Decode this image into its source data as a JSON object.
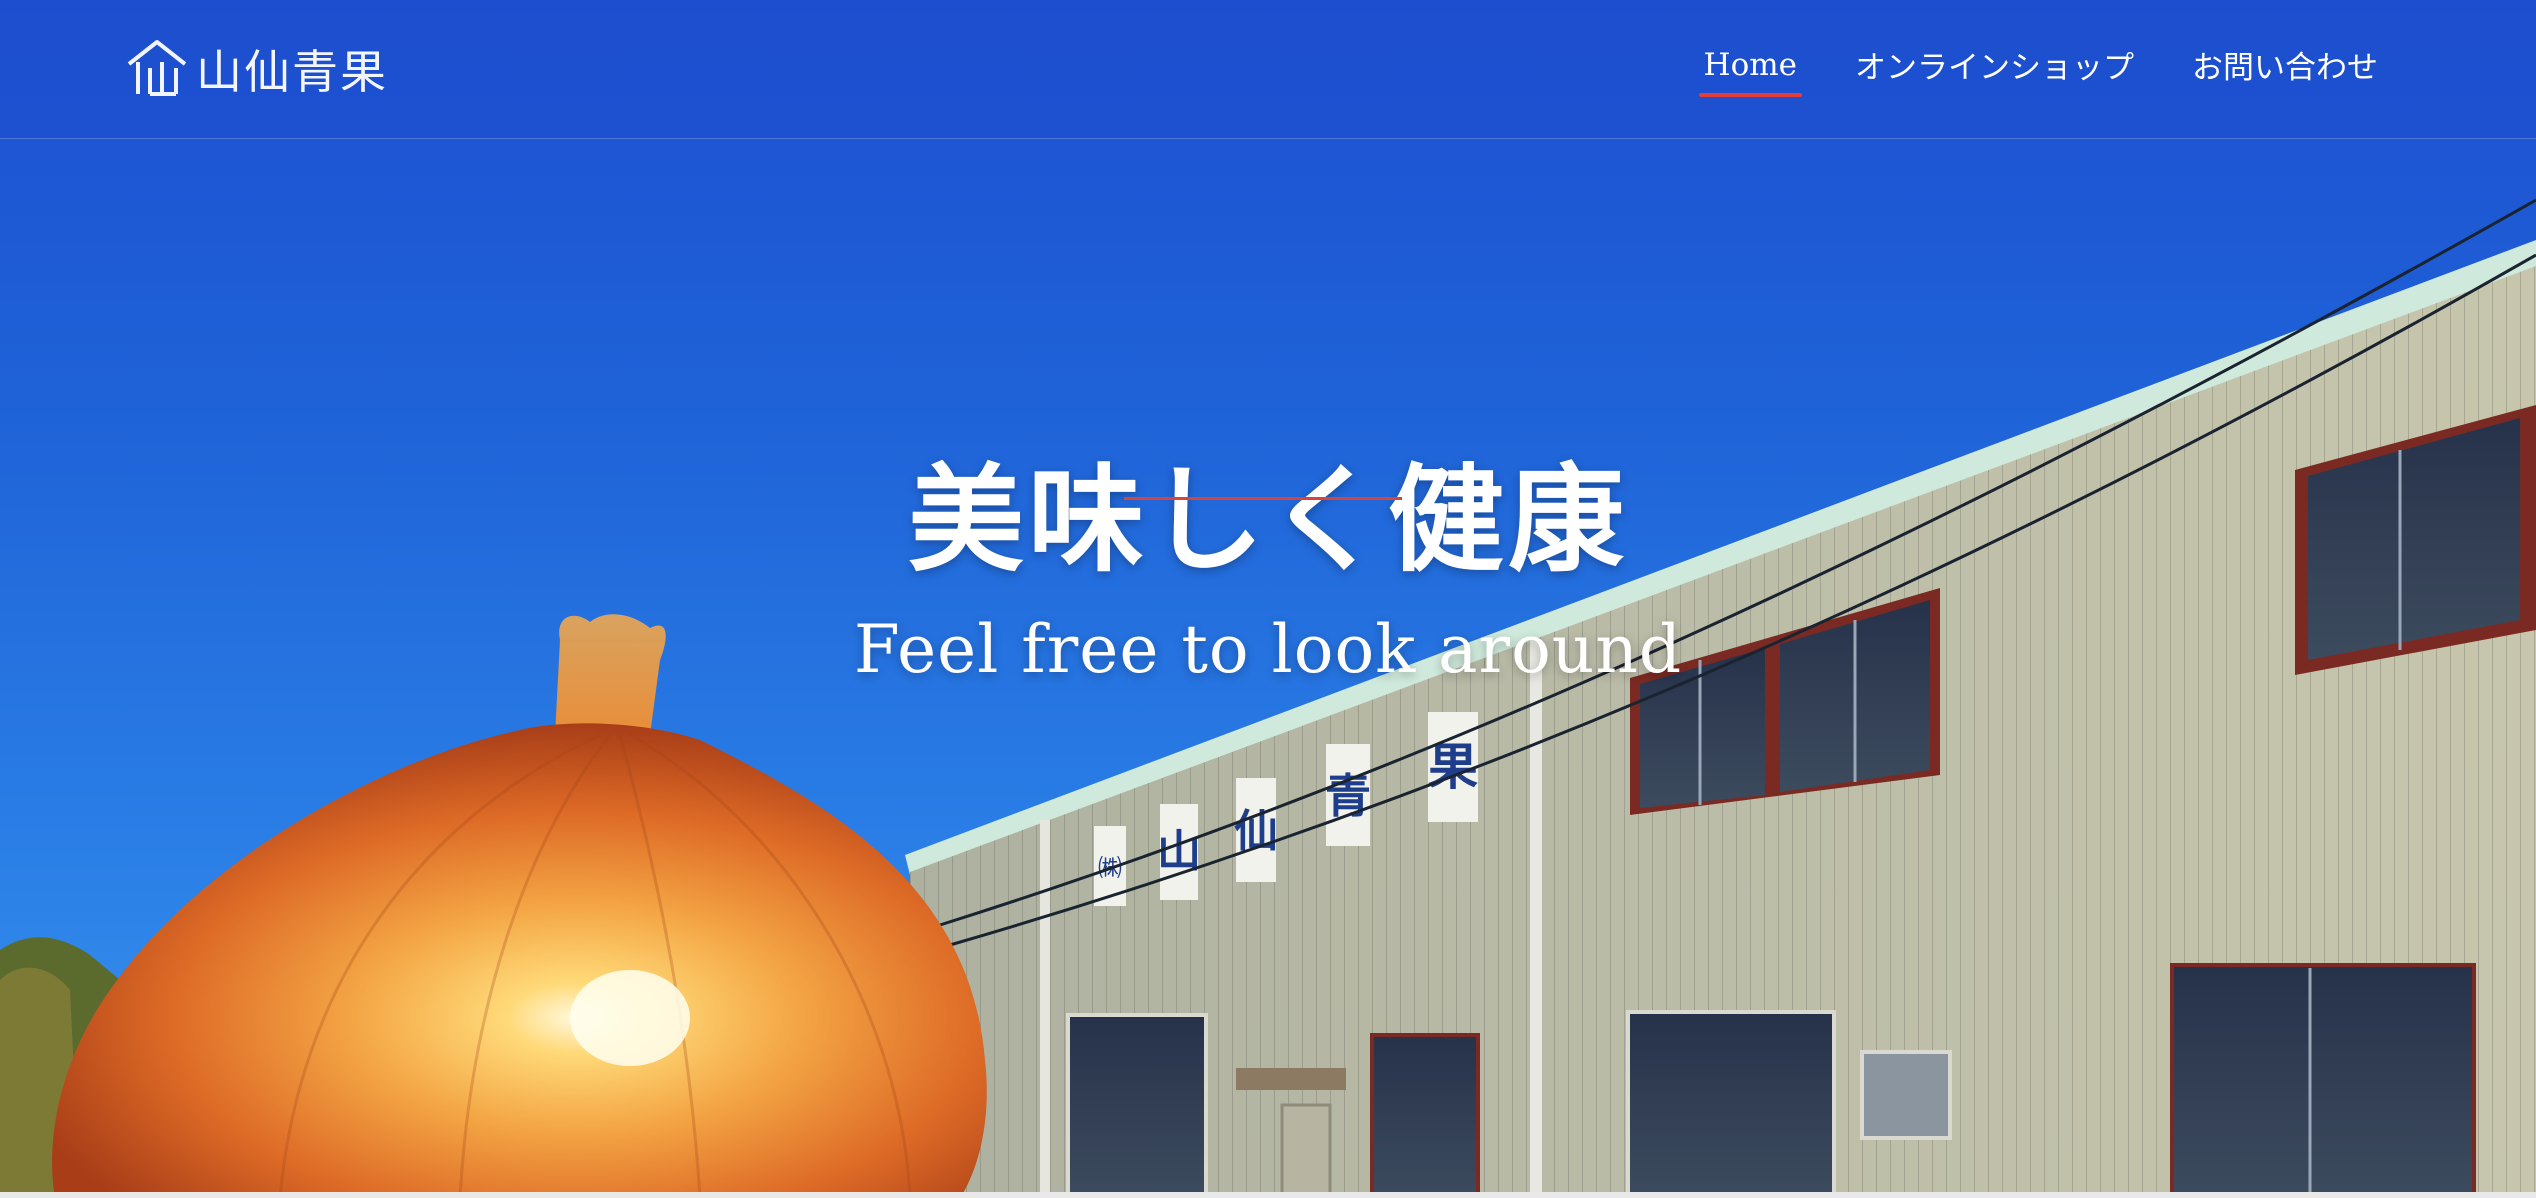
{
  "brand": {
    "name": "山仙青果",
    "logo_icon": "mountain-house-icon"
  },
  "nav": {
    "items": [
      {
        "label": "Home",
        "active": true
      },
      {
        "label": "オンラインショップ",
        "active": false
      },
      {
        "label": "お問い合わせ",
        "active": false
      }
    ]
  },
  "hero": {
    "title": "美味しく健康",
    "subtitle": "Feel free to look around",
    "building_sign": [
      "㈱",
      "山",
      "仙",
      "青",
      "果"
    ]
  },
  "colors": {
    "nav_active_underline": "#e23c3c",
    "hero_divider": "#d8443b",
    "sky": "#1f63d8"
  }
}
